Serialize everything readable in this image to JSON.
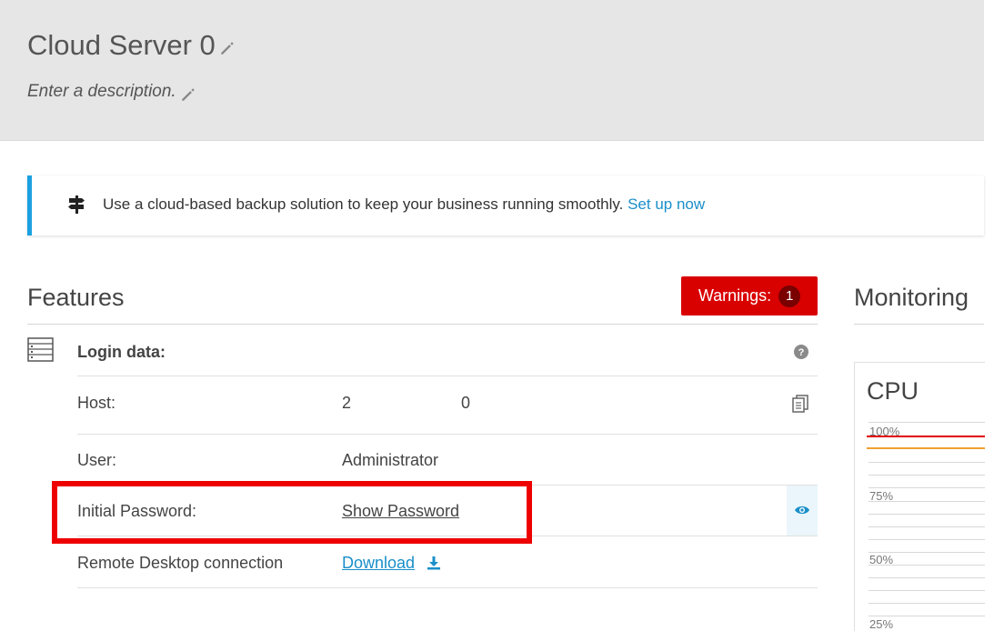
{
  "header": {
    "title": "Cloud Server 0",
    "description": "Enter a description."
  },
  "banner": {
    "text": "Use a cloud-based backup solution to keep your business running smoothly.",
    "link": "Set up now",
    "icon": "signpost-icon"
  },
  "features": {
    "title": "Features",
    "warnings_label": "Warnings:",
    "warnings_count": "1",
    "section_label": "Login data:",
    "rows": {
      "host": {
        "label": "Host:",
        "value_a": "2",
        "value_b": "0"
      },
      "user": {
        "label": "User:",
        "value": "Administrator"
      },
      "password": {
        "label": "Initial Password:",
        "value": "Show Password"
      },
      "rdp": {
        "label": "Remote Desktop connection",
        "value": "Download"
      }
    }
  },
  "monitoring": {
    "title": "Monitoring",
    "cpu_title": "CPU",
    "levels": [
      "100%",
      "75%",
      "50%",
      "25%"
    ]
  },
  "colors": {
    "accent": "#1a8fc9",
    "warning": "#d90000",
    "highlight": "#ee0000"
  }
}
